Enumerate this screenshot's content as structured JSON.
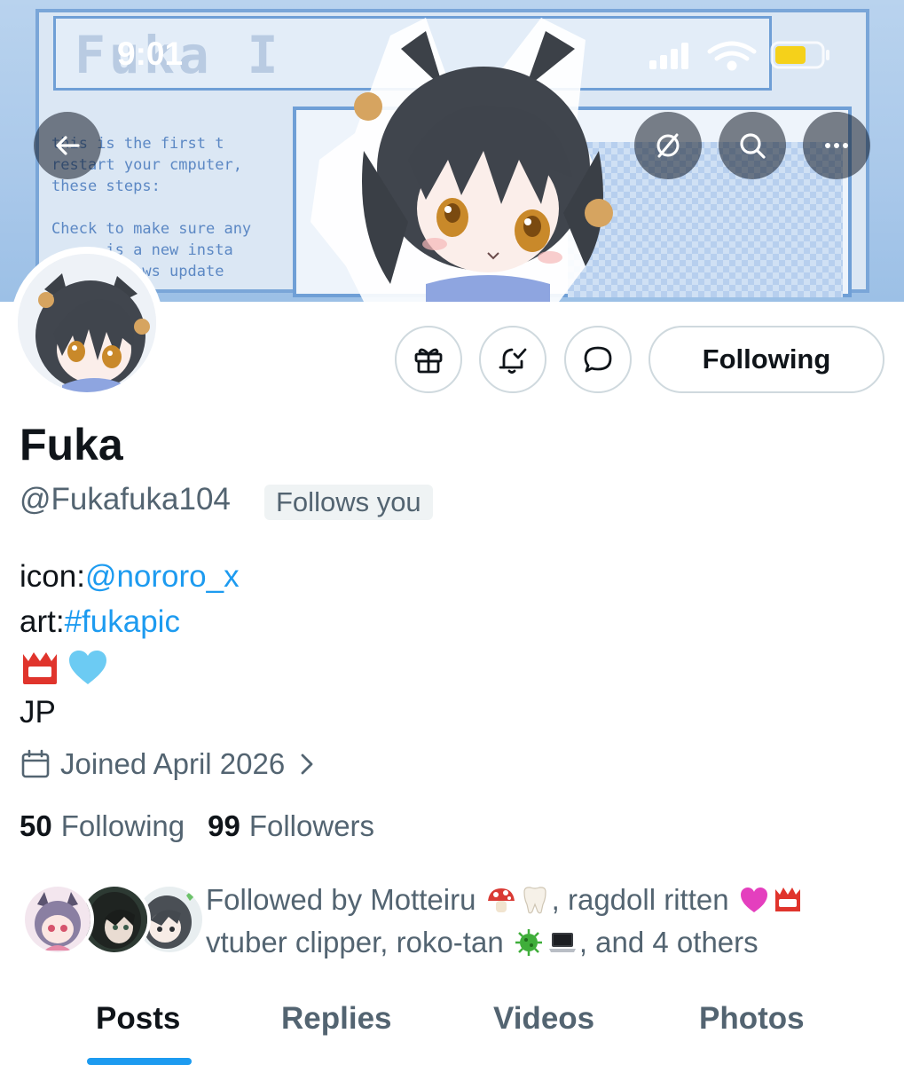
{
  "status_bar": {
    "time": "9:01"
  },
  "banner": {
    "title_text": "Fuka I",
    "text_lines": "this is the first t\nrestart your cmputer,\nthese steps:\n\nCheck to make sure any\n      is a new insta\n      indows update"
  },
  "header": {
    "back_icon": "arrow-left-icon",
    "grok_icon": "slash-circle-icon",
    "search_icon": "search-icon",
    "more_icon": "ellipsis-icon"
  },
  "actions": {
    "gift_icon": "gift-icon",
    "notify_icon": "bell-check-icon",
    "message_icon": "chat-bubble-icon",
    "follow_label": "Following"
  },
  "profile": {
    "display_name": "Fuka",
    "handle": "@Fukafuka104",
    "follows_you": "Follows you",
    "bio": {
      "icon_prefix": "icon:",
      "icon_link": "@nororo_x",
      "art_prefix": "art:",
      "art_link": "#fukapic",
      "location": "JP"
    },
    "joined": "Joined April 2026",
    "following_count": "50",
    "following_label": "Following",
    "followers_count": "99",
    "followers_label": "Followers"
  },
  "followed_by": {
    "prefix": "Followed by Motteiru",
    "name2": ", ragdoll ritten",
    "name3": "vtuber clipper, roko-tan",
    "suffix": ", and 4 others"
  },
  "tabs": [
    {
      "label": "Posts",
      "active": true
    },
    {
      "label": "Replies",
      "active": false
    },
    {
      "label": "Videos",
      "active": false
    },
    {
      "label": "Photos",
      "active": false
    }
  ],
  "colors": {
    "accent": "#1d9bf0",
    "text_primary": "#0f1419",
    "text_secondary": "#536471",
    "border": "#cfd9de"
  }
}
